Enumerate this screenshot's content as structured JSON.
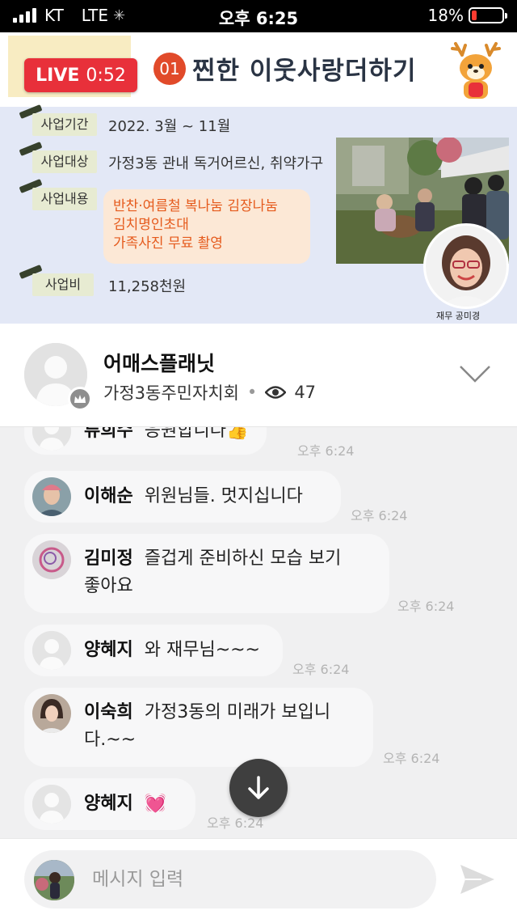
{
  "status_bar": {
    "carrier": "KT",
    "network": "LTE",
    "time": "오후 6:25",
    "battery_percent": "18%",
    "battery_level": 0.18,
    "battery_color": "#ff3b30"
  },
  "video": {
    "live_label": "LIVE",
    "live_timer": "0:52",
    "title_number": "01",
    "title": "찐한 이웃사랑더하기",
    "rows": [
      {
        "label": "사업기간",
        "value": "2022. 3월 ~ 11월"
      },
      {
        "label": "사업대상",
        "value": "가정3동 관내 독거어르신, 취약가구"
      },
      {
        "label": "사업내용",
        "lines": [
          "반찬·여름철 복나눔 김장나눔",
          "김치명인초대",
          "가족사진 무료 촬영"
        ]
      },
      {
        "label": "사업비",
        "value": "11,258천원"
      }
    ],
    "portrait_caption": "재무 공미경",
    "accent_color": "#e8303a"
  },
  "channel": {
    "name": "어매스플래닛",
    "group": "가정3동주민자치회",
    "viewers": "47"
  },
  "messages": [
    {
      "name": "류희수",
      "text": "응원합니다",
      "emoji": "👍",
      "time": "오후 6:24"
    },
    {
      "name": "이해순",
      "text": "위원님들. 멋지십니다",
      "time": "오후 6:24"
    },
    {
      "name": "김미정",
      "text": "즐겁게 준비하신 모습 보기",
      "text2": "좋아요",
      "time": "오후 6:24"
    },
    {
      "name": "양혜지",
      "text": "와 재무님~~~",
      "time": "오후 6:24"
    },
    {
      "name": "이숙희",
      "text": "가정3동의 미래가 보입니",
      "text2": "다.~~",
      "time": "오후 6:24"
    },
    {
      "name": "양혜지",
      "text": "",
      "emoji": "💓",
      "time": "오후 6:24"
    }
  ],
  "input": {
    "placeholder": "메시지 입력"
  }
}
